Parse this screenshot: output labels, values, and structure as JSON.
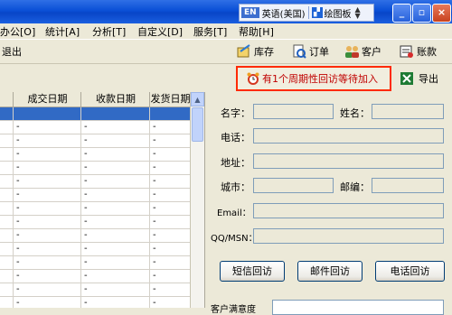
{
  "ime": {
    "lang_code": "EN",
    "language": "英语(美国)",
    "tool_glyph": "▞",
    "tool": "绘图板"
  },
  "window_controls": {
    "minimize": "_",
    "restore": "▫",
    "close": "×"
  },
  "menu": [
    {
      "label": "办公[O]"
    },
    {
      "label": "统计[A]"
    },
    {
      "label": "分析[T]"
    },
    {
      "label": "自定义[D]"
    },
    {
      "label": "服务[T]"
    },
    {
      "label": "帮助[H]"
    }
  ],
  "toolbar": {
    "exit": "退出",
    "buttons": [
      {
        "label": "库存",
        "icon": "inventory-icon"
      },
      {
        "label": "订单",
        "icon": "order-icon"
      },
      {
        "label": "客户",
        "icon": "customer-icon"
      },
      {
        "label": "账款",
        "icon": "accounts-icon"
      }
    ]
  },
  "notice": {
    "text": "有1个周期性回访等待加入",
    "icon": "alarm-clock-icon"
  },
  "export": {
    "label": "导出",
    "icon": "excel-icon"
  },
  "grid": {
    "columns": [
      "成交日期",
      "收款日期",
      "发货日期"
    ],
    "rows": [
      [
        "",
        "",
        ""
      ],
      [
        "-",
        "-",
        "-"
      ],
      [
        "-",
        "-",
        "-"
      ],
      [
        "-",
        "-",
        "-"
      ],
      [
        "-",
        "-",
        "-"
      ],
      [
        "-",
        "-",
        "-"
      ],
      [
        "-",
        "-",
        "-"
      ],
      [
        "-",
        "-",
        "-"
      ],
      [
        "-",
        "-",
        "-"
      ],
      [
        "-",
        "-",
        "-"
      ],
      [
        "-",
        "-",
        "-"
      ],
      [
        "-",
        "-",
        "-"
      ],
      [
        "-",
        "-",
        "-"
      ],
      [
        "-",
        "-",
        "-"
      ],
      [
        "-",
        "-",
        "-"
      ],
      [
        "-",
        "-",
        "-"
      ]
    ],
    "scroll_up": "▲"
  },
  "form": {
    "labels": {
      "name": "名字：",
      "surname": "姓名：",
      "phone": "电话：",
      "address": "地址：",
      "city": "城市：",
      "zip": "邮编：",
      "email": "Email：",
      "qq": "QQ/MSN："
    },
    "buttons": {
      "sms": "短信回访",
      "mail": "邮件回访",
      "call": "电话回访"
    },
    "bottom_label": "客户满意度"
  }
}
